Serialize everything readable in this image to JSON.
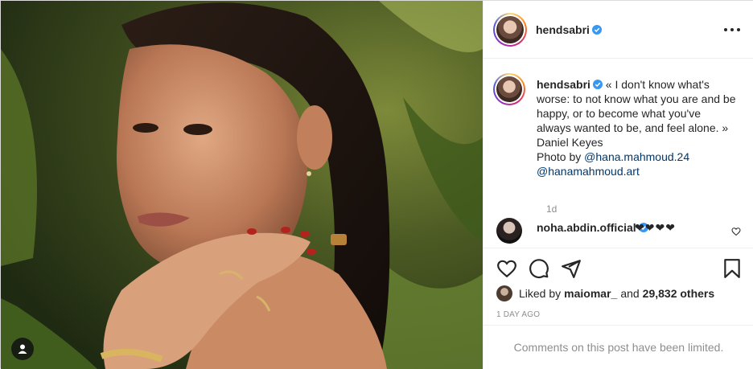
{
  "post": {
    "author": {
      "username": "hendsabri",
      "verified": true
    },
    "caption": {
      "text": "« I don't know what's worse: to not know what you are and be happy, or to become what you've always wanted to be, and feel alone. » Daniel Keyes",
      "photo_by_label": "Photo by",
      "mentions": [
        "@hana.mahmoud.24",
        "@hanamahmoud.art"
      ]
    },
    "caption_time": "1d",
    "comments": [
      {
        "username": "noha.abdin.official",
        "verified": true,
        "text": "❤❤❤❤"
      }
    ],
    "likes": {
      "prefix": "Liked by",
      "user": "maiomar_",
      "connector": "and",
      "count_text": "29,832 others"
    },
    "date": "1 DAY AGO",
    "comments_limited_text": "Comments on this post have been limited."
  },
  "icons": [
    "user-tag-icon",
    "verified-badge-icon",
    "more-options-icon",
    "heart-icon",
    "comment-icon",
    "share-icon",
    "bookmark-icon"
  ],
  "colors": {
    "link": "#00376b",
    "verified": "#3897f0",
    "muted": "#8e8e8e",
    "text": "#262626"
  }
}
